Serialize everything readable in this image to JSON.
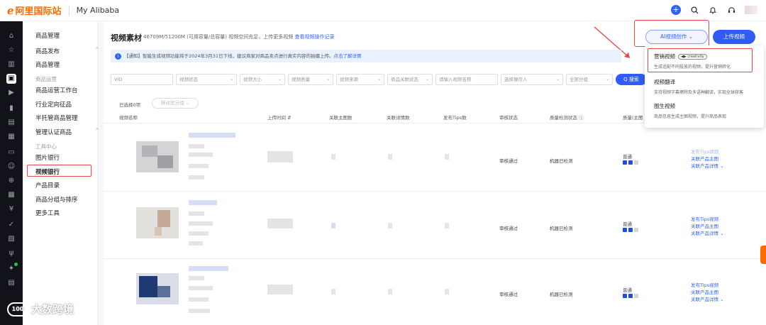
{
  "topbar": {
    "logo_text": "阿里国际站",
    "site_name": "My Alibaba",
    "icons": [
      "plus-circle-icon",
      "search-icon",
      "bell-icon",
      "headset-icon",
      "avatar"
    ]
  },
  "rail": {
    "icons": [
      "home-icon",
      "star-icon",
      "store-icon",
      "bag-icon",
      "video-icon",
      "chart-icon",
      "document-icon",
      "box-icon",
      "message-icon",
      "user-group-icon",
      "globe-icon",
      "wallet-icon",
      "shield-check-icon",
      "plant-icon",
      "sparkle-icon",
      "gift-icon"
    ]
  },
  "nav": {
    "header": "商品管理",
    "items": [
      {
        "label": "商品发布",
        "chev": "^"
      },
      {
        "label": "商品管理"
      },
      {
        "label": "商品运营",
        "grey": true
      },
      {
        "label": "商品运营工作台"
      },
      {
        "label": "行业定向征品"
      },
      {
        "label": "半托管商品管理"
      },
      {
        "label": "管理认证商品",
        "chev": "^"
      },
      {
        "label": "工具中心",
        "grey": true
      },
      {
        "label": "图片银行"
      },
      {
        "label": "视频银行",
        "active": true
      },
      {
        "label": "产品目录"
      },
      {
        "label": "商品分组与排序"
      },
      {
        "label": "更多工具"
      }
    ]
  },
  "main": {
    "title": "视频素材",
    "capacity": "46709M/51200M (可用容量/总容量) 视频空间充足，上传更多视频",
    "capacity_link": "查看视频操作记录",
    "ai_button": "AI视频创作 ⌄",
    "upload_button": "上传视频",
    "notice_icon": "i",
    "notice": "【通知】智能生成视频功能将于2024年3月31日下线，建议商家对商品卖点进行真实内容的拍摄上传。",
    "notice_link": "点击了解详情",
    "filters": [
      "VID",
      "视频状态",
      "视频大小",
      "视频质量",
      "视频来源",
      "商品关联状态",
      "请输入视频名称",
      "选择操作人",
      "全部分组"
    ],
    "search_button": "Q 搜索",
    "selected_label": "已选择0项",
    "batch_button": "移动至分组 ⌄",
    "columns": [
      "视频名称",
      "上传时间 ⇵",
      "关联主图数",
      "关联详情数",
      "发布Tips数",
      "审核状态",
      "质量检测状态 ⓘ",
      "质量(主图"
    ],
    "rows": [
      {
        "audit": "审核通过",
        "check": "机器已检测",
        "quality": "普通",
        "quality_level": 2,
        "links": [
          "发布Tips视频",
          "关联产品主图",
          "关联产品详情 ⌄"
        ]
      },
      {
        "audit": "审核通过",
        "check": "机器已检测",
        "quality": "普通",
        "quality_level": 2,
        "links": [
          "发布Tips视频",
          "关联产品主图",
          "关联产品详情 ⌄"
        ]
      },
      {
        "audit": "审核通过",
        "check": "机器已检测",
        "quality": "普通",
        "quality_level": 2,
        "links": [
          "发布Tips视频",
          "关联产品主图",
          "关联产品详情 ⌄"
        ]
      }
    ]
  },
  "dropdown": {
    "items": [
      {
        "title": "营销视频",
        "badge": "◀▶ creativity",
        "desc": "生成适配不同投放的视频，提升营销转化"
      },
      {
        "title": "视频翻译",
        "desc": "支持视频字幕擦除及多语种翻译，实现全球获客"
      },
      {
        "title": "图生视频",
        "desc": "商品信息生成主图视频，提升商品表现"
      }
    ]
  },
  "watermark": {
    "icon_text": "100",
    "text": "大数跨境"
  },
  "colors": {
    "accent": "#2f5cf5",
    "brand": "#ff6a00",
    "highlight": "#e24b4b"
  }
}
